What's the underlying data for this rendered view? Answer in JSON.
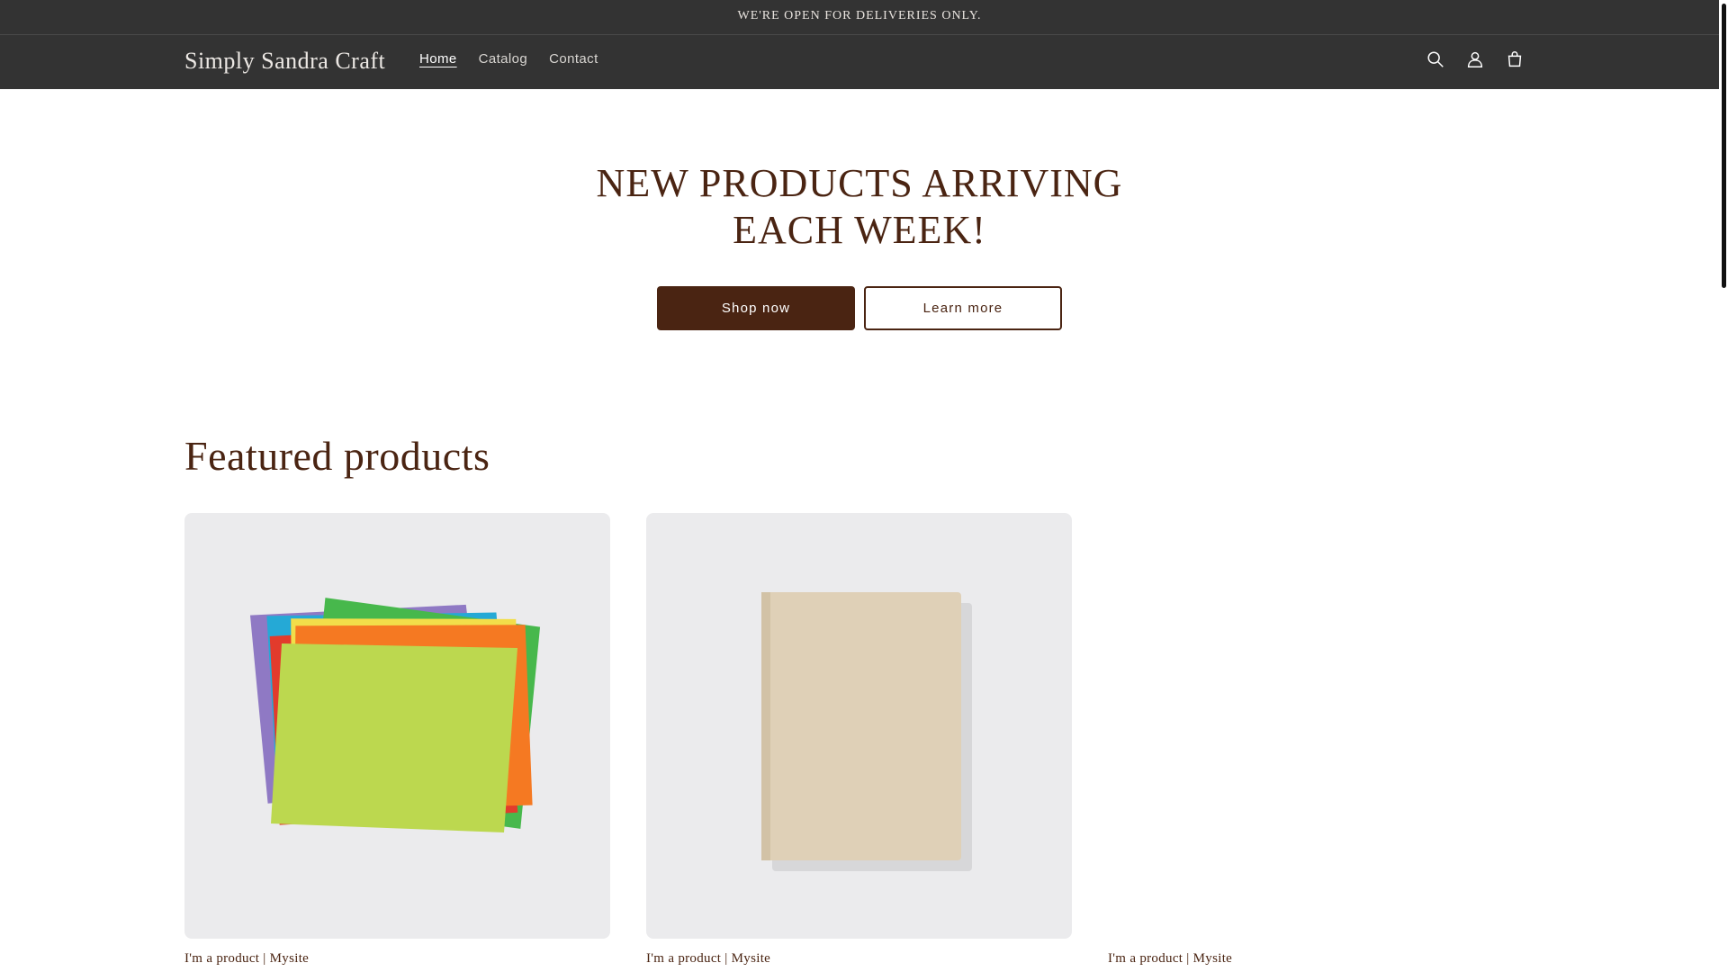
{
  "announcement": {
    "text": "WE'RE OPEN FOR DELIVERIES ONLY."
  },
  "header": {
    "logo": "Simply Sandra Craft",
    "nav": [
      {
        "label": "Home",
        "active": true
      },
      {
        "label": "Catalog",
        "active": false
      },
      {
        "label": "Contact",
        "active": false
      }
    ],
    "icons": [
      "search-icon",
      "account-icon",
      "cart-icon"
    ]
  },
  "hero": {
    "title": "NEW PRODUCTS ARRIVING EACH WEEK!",
    "primary_button": "Shop now",
    "secondary_button": "Learn more"
  },
  "featured": {
    "title": "Featured products",
    "products": [
      {
        "title": "I'm a product | Mysite",
        "image": "colored-paper-stack"
      },
      {
        "title": "I'm a product | Mysite",
        "image": "linen-notebook"
      },
      {
        "title": "I'm a product | Mysite",
        "image": ""
      }
    ]
  },
  "colors": {
    "header_bg": "#333333",
    "accent": "#4a2412",
    "card_bg": "#ebebed"
  }
}
